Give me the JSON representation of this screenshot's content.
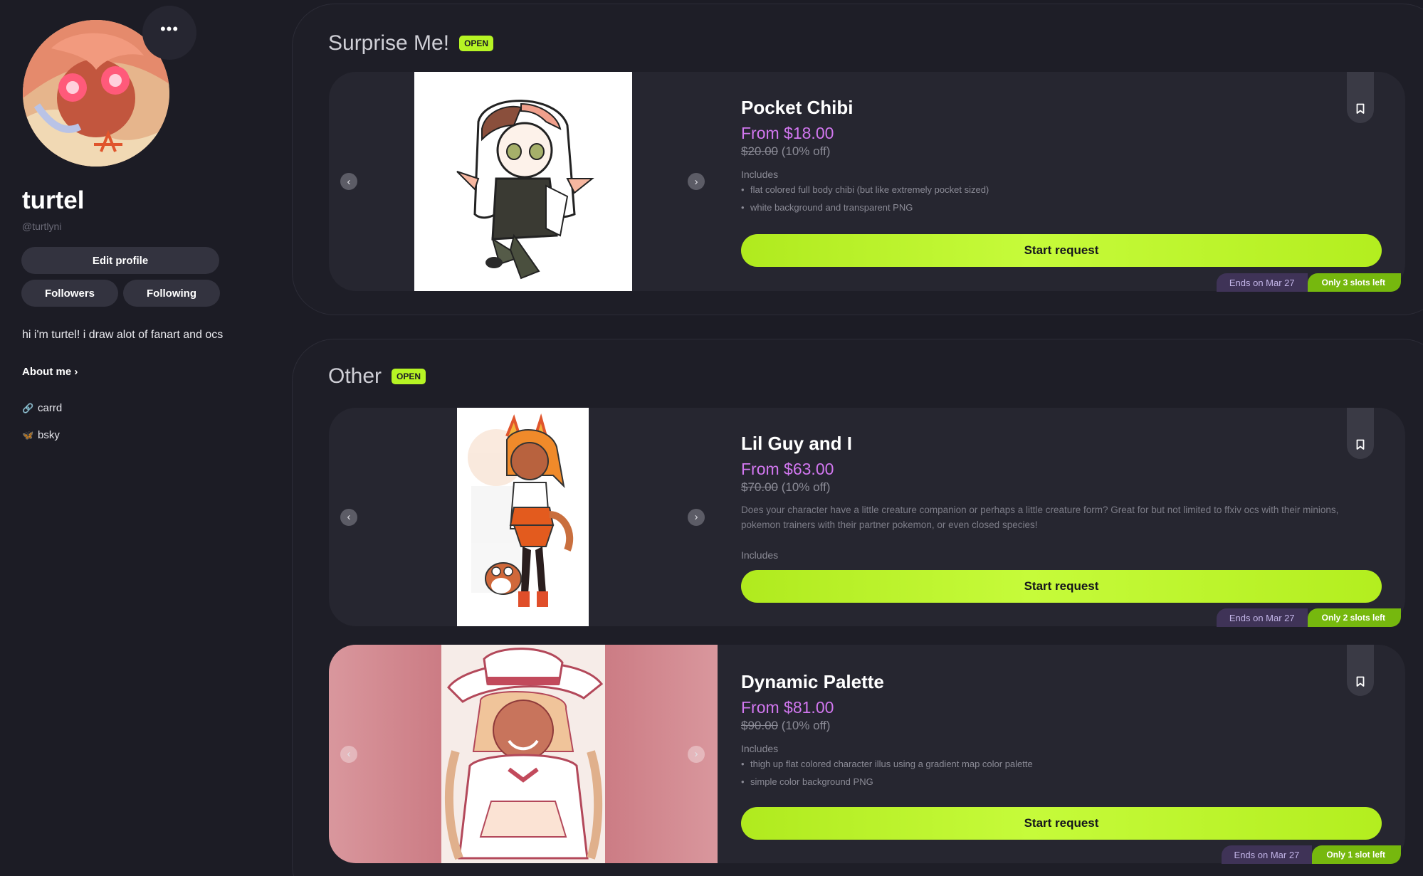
{
  "profile": {
    "username": "turtel",
    "handle": "@turtlyni",
    "more_label": "•••",
    "edit_label": "Edit profile",
    "followers_label": "Followers",
    "following_label": "Following",
    "bio": "hi i'm turtel! i draw alot of fanart and ocs",
    "about_label": "About me ›",
    "links": [
      {
        "icon": "link-icon",
        "label": "carrd"
      },
      {
        "icon": "butterfly-icon",
        "label": "bsky"
      }
    ]
  },
  "sections": [
    {
      "title": "Surprise Me!",
      "badge": "OPEN",
      "items": [
        {
          "title": "Pocket Chibi",
          "price": "From $18.00",
          "original_price": "$20.00",
          "discount": "(10% off)",
          "includes_label": "Includes",
          "includes": [
            "flat colored full body chibi (but like extremely pocket sized)",
            "white background and transparent PNG"
          ],
          "button_label": "Start request",
          "ends_label": "Ends on Mar 27",
          "slots_label": "Only 3 slots left"
        }
      ]
    },
    {
      "title": "Other",
      "badge": "OPEN",
      "items": [
        {
          "title": "Lil Guy and I",
          "price": "From $63.00",
          "original_price": "$70.00",
          "discount": "(10% off)",
          "description": "Does your character have a little creature companion or perhaps a little creature form? Great for but not limited to ffxiv ocs with their minions, pokemon trainers with their partner pokemon, or even closed species!",
          "includes_label": "Includes",
          "button_label": "Start request",
          "ends_label": "Ends on Mar 27",
          "slots_label": "Only 2 slots left"
        },
        {
          "title": "Dynamic Palette",
          "price": "From $81.00",
          "original_price": "$90.00",
          "discount": "(10% off)",
          "includes_label": "Includes",
          "includes": [
            "thigh up flat colored character illus using a gradient map color palette",
            "simple color background PNG"
          ],
          "button_label": "Start request",
          "ends_label": "Ends on Mar 27",
          "slots_label": "Only 1 slot left"
        }
      ]
    }
  ],
  "icons": {
    "prev": "‹",
    "next": "›",
    "bookmark": "bookmark-icon"
  },
  "colors": {
    "background": "#1c1c25",
    "accent_green": "#b6f424",
    "price_purple": "#d277f0",
    "slots_green": "#76b80e"
  }
}
